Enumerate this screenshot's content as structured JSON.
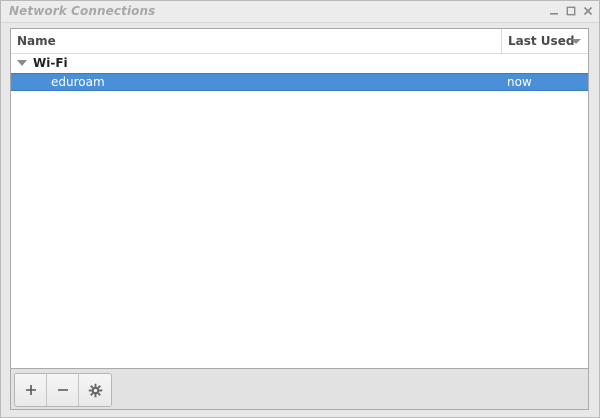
{
  "window": {
    "title": "Network Connections",
    "controls": [
      "minimize-icon",
      "maximize-icon",
      "close-icon"
    ]
  },
  "table": {
    "columns": {
      "name": "Name",
      "last_used": "Last Used"
    },
    "groups": [
      {
        "label": "Wi-Fi",
        "expanded": true,
        "connections": [
          {
            "name": "eduroam",
            "last_used": "now",
            "selected": true
          }
        ]
      }
    ]
  },
  "toolbar": {
    "buttons": [
      "add-icon",
      "remove-icon",
      "settings-gear-icon"
    ]
  },
  "colors": {
    "selection": "#4a90d9",
    "selection_text": "#ffffff",
    "title_text": "#a8a8a8"
  }
}
